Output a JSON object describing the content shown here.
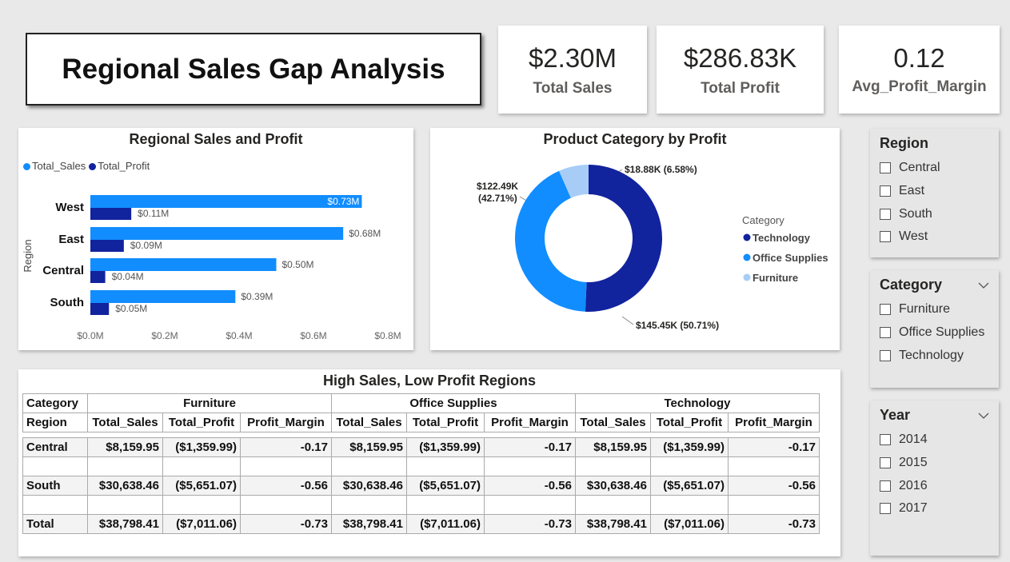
{
  "title": "Regional Sales Gap Analysis",
  "kpis": [
    {
      "value": "$2.30M",
      "label": "Total Sales"
    },
    {
      "value": "$286.83K",
      "label": "Total Profit"
    },
    {
      "value": "0.12",
      "label": "Avg_Profit_Margin"
    }
  ],
  "bar_chart": {
    "title": "Regional Sales and Profit",
    "legend": [
      "Total_Sales",
      "Total_Profit"
    ],
    "ylabel": "Region",
    "ticks": [
      "$0.0M",
      "$0.2M",
      "$0.4M",
      "$0.6M",
      "$0.8M"
    ]
  },
  "donut_chart": {
    "title": "Product Category by Profit",
    "legend_title": "Category",
    "legend": [
      "Technology",
      "Office Supplies",
      "Furniture"
    ],
    "labels": {
      "technology": "$145.45K (50.71%)",
      "office_line1": "$122.49K",
      "office_line2": "(42.71%)",
      "furniture": "$18.88K (6.58%)"
    }
  },
  "chart_data": [
    {
      "type": "bar",
      "title": "Regional Sales and Profit",
      "categories": [
        "West",
        "East",
        "Central",
        "South"
      ],
      "series": [
        {
          "name": "Total_Sales",
          "values": [
            0.73,
            0.68,
            0.5,
            0.39
          ],
          "labels": [
            "$0.73M",
            "$0.68M",
            "$0.50M",
            "$0.39M"
          ],
          "color": "#118dff"
        },
        {
          "name": "Total_Profit",
          "values": [
            0.11,
            0.09,
            0.04,
            0.05
          ],
          "labels": [
            "$0.11M",
            "$0.09M",
            "$0.04M",
            "$0.05M"
          ],
          "color": "#12239e"
        }
      ],
      "xlabel": "",
      "ylabel": "Region",
      "xlim": [
        0,
        0.8
      ],
      "unit": "$M",
      "legend": "top-left"
    },
    {
      "type": "pie",
      "title": "Product Category by Profit",
      "donut": true,
      "slices": [
        {
          "name": "Technology",
          "value": 145.45,
          "percent": 50.71,
          "color": "#12239e"
        },
        {
          "name": "Office Supplies",
          "value": 122.49,
          "percent": 42.71,
          "color": "#118dff"
        },
        {
          "name": "Furniture",
          "value": 18.88,
          "percent": 6.58,
          "color": "#a7cdf7"
        }
      ],
      "legend": "right"
    }
  ],
  "table": {
    "title": "High Sales, Low Profit Regions",
    "corner_top": "Category",
    "corner_bottom": "Region",
    "groups": [
      "Furniture",
      "Office Supplies",
      "Technology"
    ],
    "columns": [
      "Total_Sales",
      "Total_Profit",
      "Profit_Margin"
    ],
    "rows": [
      {
        "region": "Central",
        "values": [
          "$8,159.95",
          "($1,359.99)",
          "-0.17",
          "$8,159.95",
          "($1,359.99)",
          "-0.17",
          "$8,159.95",
          "($1,359.99)",
          "-0.17"
        ]
      },
      {
        "region": "South",
        "values": [
          "$30,638.46",
          "($5,651.07)",
          "-0.56",
          "$30,638.46",
          "($5,651.07)",
          "-0.56",
          "$30,638.46",
          "($5,651.07)",
          "-0.56"
        ]
      },
      {
        "region": "Total",
        "values": [
          "$38,798.41",
          "($7,011.06)",
          "-0.73",
          "$38,798.41",
          "($7,011.06)",
          "-0.73",
          "$38,798.41",
          "($7,011.06)",
          "-0.73"
        ]
      }
    ]
  },
  "slicers": [
    {
      "title": "Region",
      "options": [
        "Central",
        "East",
        "South",
        "West"
      ],
      "chevron": false
    },
    {
      "title": "Category",
      "options": [
        "Furniture",
        "Office Supplies",
        "Technology"
      ],
      "chevron": true
    },
    {
      "title": "Year",
      "options": [
        "2014",
        "2015",
        "2016",
        "2017"
      ],
      "chevron": true
    }
  ]
}
